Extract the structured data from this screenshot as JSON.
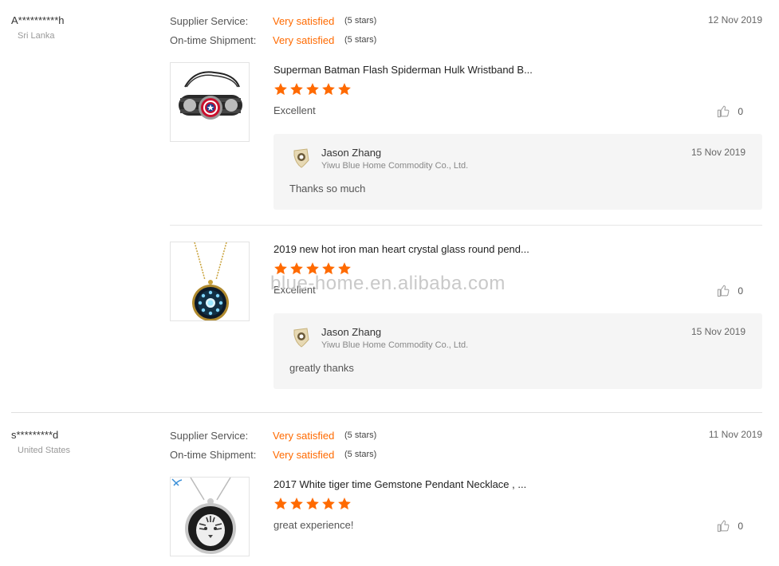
{
  "colors": {
    "accent": "#ff6a00",
    "star": "#ff6a00"
  },
  "reviews": [
    {
      "buyer": "A**********h",
      "country": "Sri Lanka",
      "date": "12 Nov 2019",
      "ratings": [
        {
          "label": "Supplier Service:",
          "value": "Very satisfied",
          "stars": "(5 stars)"
        },
        {
          "label": "On-time Shipment:",
          "value": "Very satisfied",
          "stars": "(5 stars)"
        }
      ],
      "products": [
        {
          "title": "Superman Batman Flash Spiderman Hulk Wristband B...",
          "rating": 5,
          "feedback": "Excellent",
          "likes": "0",
          "thumb_icon": "wristband-image",
          "reply": {
            "name": "Jason Zhang",
            "company": "Yiwu Blue Home Commodity Co., Ltd.",
            "date": "15 Nov 2019",
            "text": "Thanks so much"
          }
        },
        {
          "title": "2019 new hot iron man heart crystal glass round pend...",
          "rating": 5,
          "feedback": "Excellent",
          "likes": "0",
          "thumb_icon": "pendant-image",
          "reply": {
            "name": "Jason Zhang",
            "company": "Yiwu Blue Home Commodity Co., Ltd.",
            "date": "15 Nov 2019",
            "text": "greatly thanks"
          }
        }
      ]
    },
    {
      "buyer": "s*********d",
      "country": "United States",
      "date": "11 Nov 2019",
      "ratings": [
        {
          "label": "Supplier Service:",
          "value": "Very satisfied",
          "stars": "(5 stars)"
        },
        {
          "label": "On-time Shipment:",
          "value": "Very satisfied",
          "stars": "(5 stars)"
        }
      ],
      "products": [
        {
          "title": "2017 White tiger time Gemstone Pendant Necklace , ...",
          "rating": 5,
          "feedback": "great experience!",
          "likes": "0",
          "thumb_icon": "tiger-pendant-image"
        }
      ]
    }
  ],
  "watermark": "blue-home.en.alibaba.com"
}
